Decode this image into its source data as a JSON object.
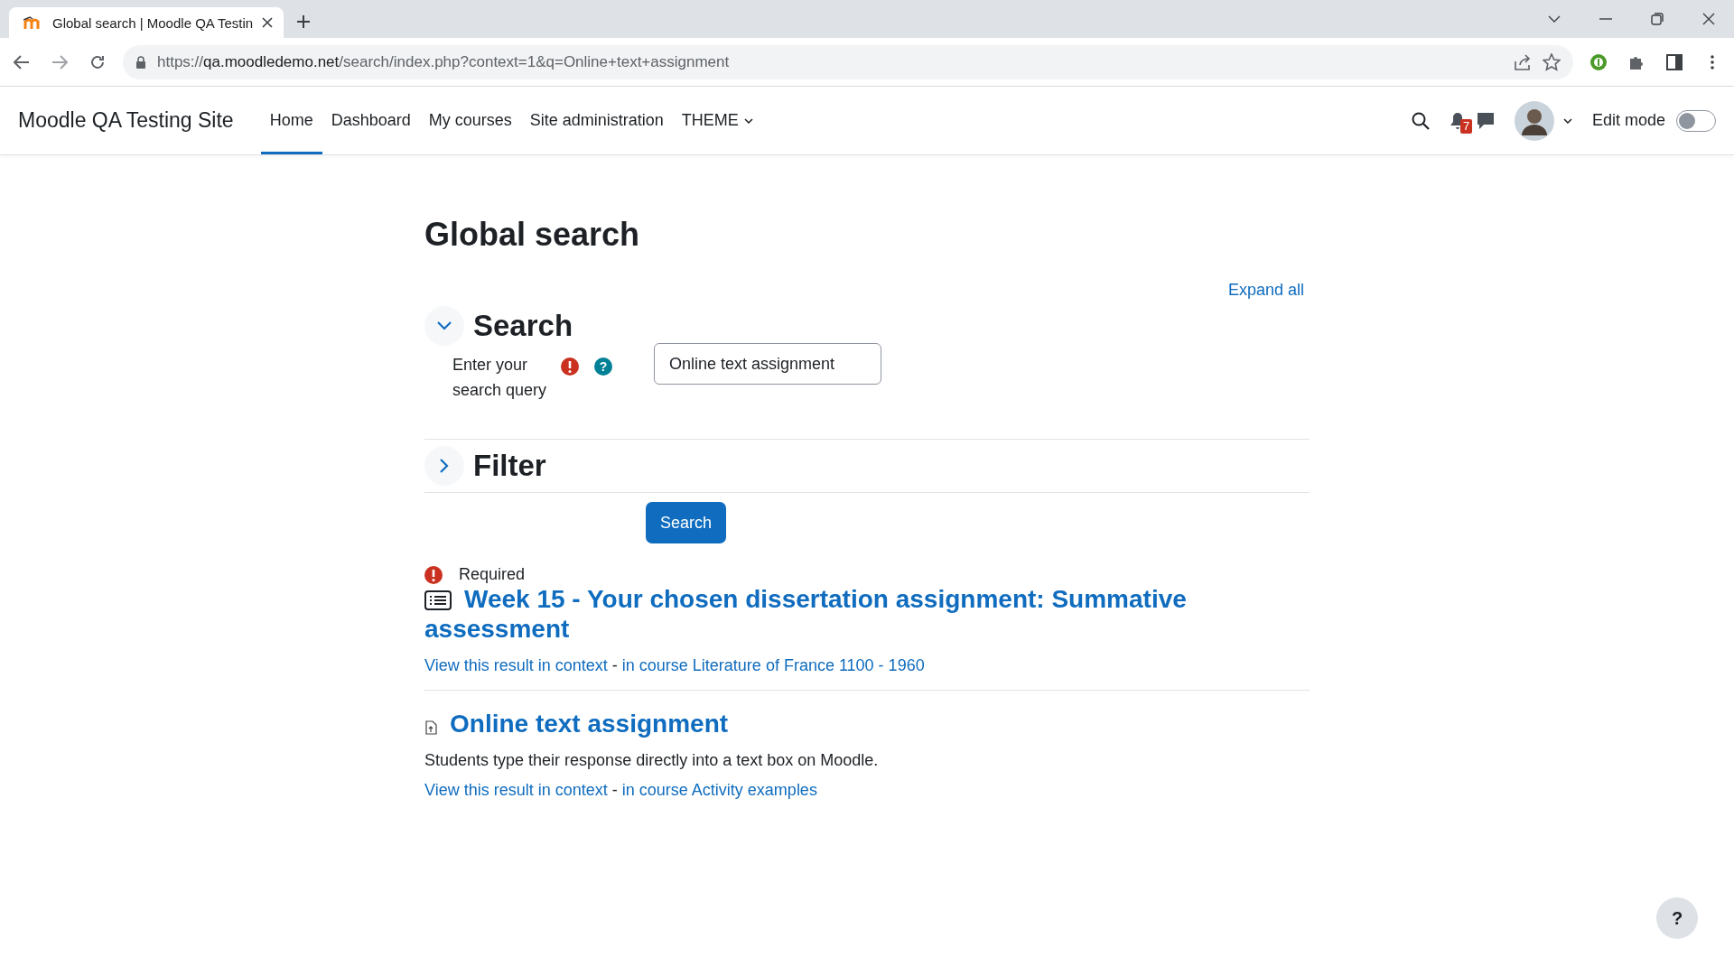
{
  "browser": {
    "tab_title": "Global search | Moodle QA Testin",
    "url_scheme": "https://",
    "url_host": "qa.moodledemo.net",
    "url_path": "/search/index.php?context=1&q=Online+text+assignment"
  },
  "site": {
    "name": "Moodle QA Testing Site",
    "nav": [
      {
        "label": "Home",
        "selected": true,
        "has_menu": false
      },
      {
        "label": "Dashboard",
        "selected": false,
        "has_menu": false
      },
      {
        "label": "My courses",
        "selected": false,
        "has_menu": false
      },
      {
        "label": "Site administration",
        "selected": false,
        "has_menu": false
      },
      {
        "label": "THEME",
        "selected": false,
        "has_menu": true
      }
    ],
    "notification_count": "7",
    "edit_mode": {
      "label": "Edit mode",
      "on": false
    }
  },
  "page": {
    "title": "Global search",
    "expand_all": "Expand all",
    "sections": [
      {
        "title": "Search",
        "expanded": true
      },
      {
        "title": "Filter",
        "expanded": false
      }
    ],
    "query": {
      "label": "Enter your search query",
      "help_icon": "?",
      "value": "Online text assignment"
    },
    "submit": "Search",
    "required_note": "Required"
  },
  "results": [
    {
      "kind": "list",
      "title": "Week 15 - Your chosen dissertation assignment: Summative assessment",
      "context_link": "View this result in context",
      "separator": "-",
      "course_link": "in course Literature of France 1100 - 1960"
    },
    {
      "kind": "file",
      "title": "Online text assignment",
      "description": "Students type their response directly into a text box on Moodle.",
      "context_link": "View this result in context",
      "separator": "-",
      "course_link": "in course Activity examples"
    }
  ],
  "help_button": "?"
}
